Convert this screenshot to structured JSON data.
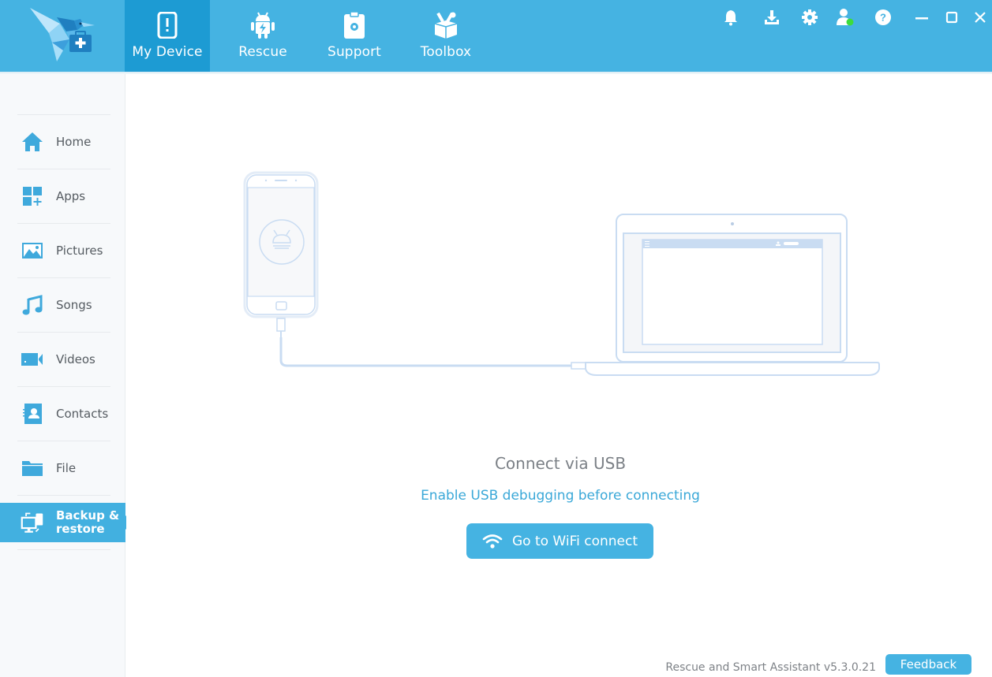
{
  "app": {
    "name": "Rescue and Smart Assistant",
    "logo_icon": "hummingbird-toolbox-logo"
  },
  "nav": {
    "tabs": [
      {
        "label": "My Device",
        "icon": "phone-alert-icon",
        "active": true
      },
      {
        "label": "Rescue",
        "icon": "android-bolt-icon",
        "active": false
      },
      {
        "label": "Support",
        "icon": "clipboard-gear-icon",
        "active": false
      },
      {
        "label": "Toolbox",
        "icon": "toolbox-icon",
        "active": false
      }
    ]
  },
  "window_controls": {
    "items": [
      {
        "name": "notifications",
        "icon": "bell-icon"
      },
      {
        "name": "downloads",
        "icon": "download-icon"
      },
      {
        "name": "settings",
        "icon": "gear-icon"
      },
      {
        "name": "account",
        "icon": "user-online-icon",
        "status_color": "#3ddc3d"
      },
      {
        "name": "help",
        "icon": "help-icon"
      },
      {
        "name": "minimize",
        "icon": "minimize-icon"
      },
      {
        "name": "maximize",
        "icon": "maximize-icon"
      },
      {
        "name": "close",
        "icon": "close-icon"
      }
    ]
  },
  "sidebar": {
    "items": [
      {
        "label": "Home",
        "icon": "home-icon"
      },
      {
        "label": "Apps",
        "icon": "apps-icon"
      },
      {
        "label": "Pictures",
        "icon": "picture-icon"
      },
      {
        "label": "Songs",
        "icon": "music-note-icon"
      },
      {
        "label": "Videos",
        "icon": "video-camera-icon"
      },
      {
        "label": "Contacts",
        "icon": "contact-card-icon"
      },
      {
        "label": "File",
        "icon": "folder-icon"
      },
      {
        "label": "Backup & restore",
        "label_line1": "Backup &",
        "label_line2": "restore",
        "icon": "backup-restore-icon",
        "active": true
      }
    ]
  },
  "main": {
    "headline": "Connect via USB",
    "hint": "Enable USB debugging before connecting",
    "wifi_button": {
      "label": "Go to WiFi connect",
      "icon": "wifi-icon"
    }
  },
  "footer": {
    "version_text": "Rescue and Smart Assistant v5.3.0.21",
    "feedback_label": "Feedback"
  },
  "colors": {
    "brand": "#45b3e2",
    "brand_active": "#1d9bd3",
    "link": "#3aa8d8",
    "illustration_line": "#c9dcf2"
  }
}
